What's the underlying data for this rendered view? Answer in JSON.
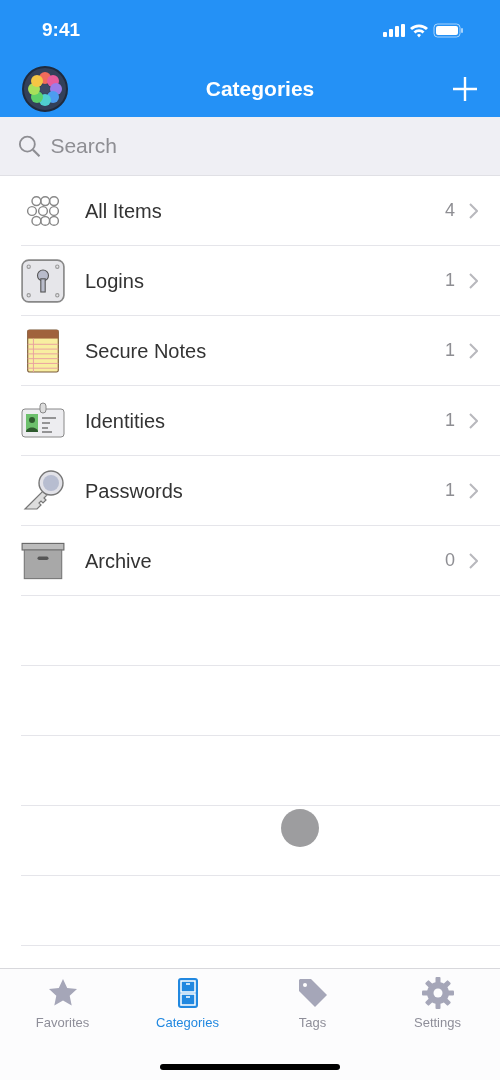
{
  "status_bar": {
    "time": "9:41"
  },
  "nav_bar": {
    "title": "Categories"
  },
  "search": {
    "placeholder": "Search"
  },
  "categories": [
    {
      "kind": "all",
      "label": "All Items",
      "count": "4"
    },
    {
      "kind": "login",
      "label": "Logins",
      "count": "1"
    },
    {
      "kind": "note",
      "label": "Secure Notes",
      "count": "1"
    },
    {
      "kind": "identity",
      "label": "Identities",
      "count": "1"
    },
    {
      "kind": "password",
      "label": "Passwords",
      "count": "1"
    },
    {
      "kind": "archive",
      "label": "Archive",
      "count": "0"
    }
  ],
  "tabs": [
    {
      "kind": "favorites",
      "label": "Favorites",
      "selected": false
    },
    {
      "kind": "categories",
      "label": "Categories",
      "selected": true
    },
    {
      "kind": "tags",
      "label": "Tags",
      "selected": false
    },
    {
      "kind": "settings",
      "label": "Settings",
      "selected": false
    }
  ]
}
